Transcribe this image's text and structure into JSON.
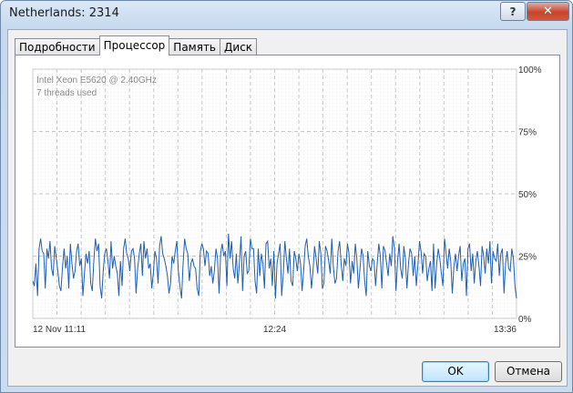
{
  "window": {
    "title": "Netherlands: 2314",
    "help_label": "?",
    "close_label": "✕"
  },
  "tabs": [
    {
      "label": "Подробности",
      "active": false
    },
    {
      "label": "Процессор",
      "active": true
    },
    {
      "label": "Память",
      "active": false
    },
    {
      "label": "Диск",
      "active": false
    }
  ],
  "buttons": {
    "ok": "OK",
    "cancel": "Отмена"
  },
  "colors": {
    "line": "#1f5fb4",
    "grid": "#c8c8c8"
  },
  "chart_data": {
    "type": "line",
    "info_line1": "Intel Xeon  E5620 @ 2.40GHz",
    "info_line2": "7 threads used",
    "y_ticks": [
      "100%",
      "75%",
      "50%",
      "25%",
      "0%"
    ],
    "x_ticks": [
      "12 Nov 11:11",
      "12:24",
      "13:36"
    ],
    "ylim": [
      0,
      100
    ],
    "grid": true,
    "values": [
      15,
      13,
      22,
      9,
      28,
      32,
      27,
      26,
      12,
      28,
      24,
      31,
      20,
      17,
      29,
      24,
      19,
      13,
      11,
      21,
      28,
      20,
      25,
      12,
      30,
      22,
      16,
      19,
      27,
      30,
      21,
      24,
      9,
      18,
      26,
      22,
      27,
      14,
      11,
      23,
      32,
      27,
      30,
      13,
      8,
      19,
      26,
      28,
      23,
      16,
      31,
      20,
      25,
      21,
      18,
      9,
      23,
      13,
      28,
      32,
      26,
      24,
      19,
      27,
      28,
      24,
      10,
      20,
      26,
      30,
      17,
      31,
      24,
      28,
      20,
      22,
      12,
      18,
      27,
      24,
      14,
      29,
      33,
      26,
      24,
      21,
      17,
      10,
      14,
      25,
      22,
      27,
      31,
      19,
      13,
      8,
      22,
      32,
      28,
      26,
      15,
      22,
      24,
      21,
      20,
      12,
      9,
      27,
      30,
      28,
      21,
      27,
      26,
      17,
      21,
      14,
      19,
      28,
      24,
      10,
      26,
      30,
      25,
      27,
      13,
      34,
      24,
      31,
      20,
      16,
      26,
      14,
      22,
      33,
      11,
      25,
      27,
      18,
      19,
      32,
      28,
      28,
      15,
      10,
      28,
      17,
      26,
      22,
      12,
      30,
      31,
      20,
      24,
      13,
      27,
      8,
      22,
      26,
      30,
      9,
      18,
      31,
      24,
      18,
      28,
      15,
      13,
      27,
      24,
      19,
      26,
      22,
      11,
      19,
      29,
      32,
      25,
      21,
      12,
      19,
      29,
      24,
      18,
      31,
      26,
      12,
      14,
      29,
      27,
      23,
      18,
      32,
      21,
      14,
      16,
      27,
      31,
      22,
      15,
      24,
      21,
      30,
      26,
      14,
      23,
      18,
      30,
      24,
      12,
      20,
      28,
      25,
      15,
      9,
      27,
      21,
      19,
      24,
      23,
      13,
      22,
      30,
      25,
      12,
      29,
      27,
      22,
      17,
      26,
      21,
      33,
      28,
      11,
      23,
      30,
      20,
      16,
      29,
      24,
      12,
      22,
      28,
      26,
      17,
      25,
      13,
      21,
      31,
      27,
      18,
      26,
      25,
      15,
      20,
      23,
      11,
      30,
      12,
      22,
      28,
      24,
      18,
      13,
      32,
      26,
      20,
      28,
      23,
      10,
      21,
      26,
      19,
      25,
      29,
      15,
      22,
      24,
      9,
      28,
      30,
      19,
      26,
      14,
      23,
      27,
      21,
      13,
      29,
      25,
      18,
      28,
      22,
      31,
      14,
      27,
      24,
      23,
      30,
      17,
      26,
      28,
      10,
      22,
      27,
      20,
      19,
      28,
      24,
      13,
      8
    ]
  }
}
